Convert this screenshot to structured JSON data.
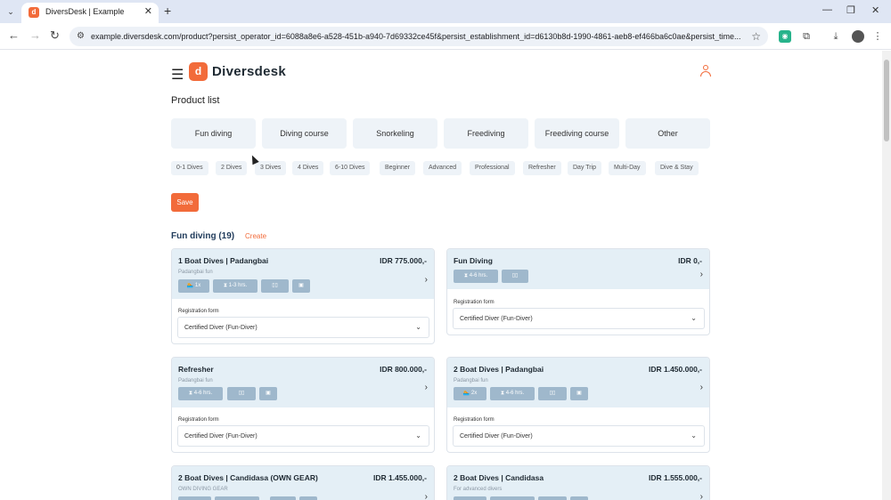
{
  "browser": {
    "tab_title": "DiversDesk | Example",
    "tab_favicon": "d",
    "url": "example.diversdesk.com/product?persist_operator_id=6088a8e6-a528-451b-a940-7d69332ce45f&persist_establishment_id=d6130b8d-1990-4861-aeb8-ef466ba6c0ae&persist_time..."
  },
  "header": {
    "logo_mark": "d",
    "logo_text": "Diversdesk"
  },
  "page_title": "Product list",
  "categories": [
    "Fun diving",
    "Diving course",
    "Snorkeling",
    "Freediving",
    "Freediving course",
    "Other"
  ],
  "filters": [
    "0-1 Dives",
    "2 Dives",
    "3 Dives",
    "4 Dives",
    "6-10 Dives",
    "Beginner",
    "Advanced",
    "Professional",
    "Refresher",
    "Day Trip",
    "Multi-Day",
    "Dive & Stay"
  ],
  "save_label": "Save",
  "section": {
    "title": "Fun diving (19)",
    "create_label": "Create"
  },
  "cards": [
    {
      "name": "1 Boat Dives | Padangbai",
      "price": "IDR 775.000,-",
      "subtitle": "Padangbai fun",
      "badges": [
        {
          "icon": "diver-icon",
          "text": "1x"
        },
        {
          "icon": "hourglass-icon",
          "text": "1-3 hrs."
        },
        {
          "icon": "gear-icon",
          "text": ""
        },
        {
          "icon": "bus-icon",
          "text": ""
        }
      ],
      "reg_label": "Registration form",
      "reg_value": "Certified Diver (Fun-Diver)"
    },
    {
      "name": "Fun Diving",
      "price": "IDR 0,-",
      "subtitle": "",
      "badges": [
        {
          "icon": "hourglass-icon",
          "text": "4-6 hrs."
        },
        {
          "icon": "gear-icon",
          "text": ""
        }
      ],
      "reg_label": "Registration form",
      "reg_value": "Certified Diver (Fun-Diver)"
    },
    {
      "name": "Refresher",
      "price": "IDR 800.000,-",
      "subtitle": "Padangbai fun",
      "badges": [
        {
          "icon": "hourglass-icon",
          "text": "4-6 hrs."
        },
        {
          "icon": "gear-icon",
          "text": ""
        },
        {
          "icon": "bus-icon",
          "text": ""
        }
      ],
      "reg_label": "Registration form",
      "reg_value": "Certified Diver (Fun-Diver)"
    },
    {
      "name": "2 Boat Dives | Padangbai",
      "price": "IDR 1.450.000,-",
      "subtitle": "Padangbai fun",
      "badges": [
        {
          "icon": "diver-icon",
          "text": "2x"
        },
        {
          "icon": "hourglass-icon",
          "text": "4-6 hrs."
        },
        {
          "icon": "gear-icon",
          "text": ""
        },
        {
          "icon": "bus-icon",
          "text": ""
        }
      ],
      "reg_label": "Registration form",
      "reg_value": "Certified Diver (Fun-Diver)"
    },
    {
      "name": "2 Boat Dives | Candidasa (OWN GEAR)",
      "price": "IDR 1.455.000,-",
      "subtitle": "OWN DIVING GEAR",
      "badges": [],
      "reg_label": "",
      "reg_value": ""
    },
    {
      "name": "2 Boat Dives | Candidasa",
      "price": "IDR 1.555.000,-",
      "subtitle": "For advanced divers",
      "badges": [],
      "reg_label": "",
      "reg_value": ""
    }
  ]
}
